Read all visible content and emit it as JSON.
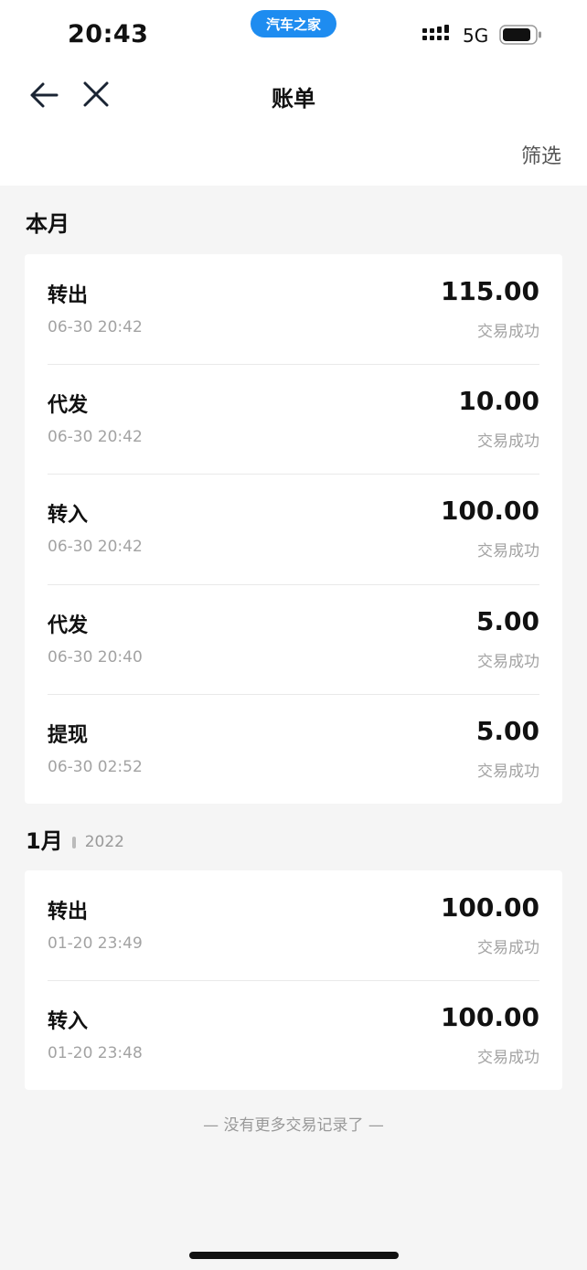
{
  "status_bar": {
    "time": "20:43",
    "app_pill": "汽车之家",
    "network": "5G",
    "icons": [
      "signal-icon",
      "battery-icon"
    ]
  },
  "nav": {
    "title": "账单",
    "back_icon": "back-arrow-icon",
    "close_icon": "close-icon",
    "filter_label": "筛选"
  },
  "sections": [
    {
      "title": "本月",
      "subtitle": "",
      "items": [
        {
          "type": "转出",
          "time": "06-30 20:42",
          "amount": "115.00",
          "status": "交易成功"
        },
        {
          "type": "代发",
          "time": "06-30 20:42",
          "amount": "10.00",
          "status": "交易成功"
        },
        {
          "type": "转入",
          "time": "06-30 20:42",
          "amount": "100.00",
          "status": "交易成功"
        },
        {
          "type": "代发",
          "time": "06-30 20:40",
          "amount": "5.00",
          "status": "交易成功"
        },
        {
          "type": "提现",
          "time": "06-30 02:52",
          "amount": "5.00",
          "status": "交易成功"
        }
      ]
    },
    {
      "title": "1月",
      "subtitle": "2022",
      "items": [
        {
          "type": "转出",
          "time": "01-20 23:49",
          "amount": "100.00",
          "status": "交易成功"
        },
        {
          "type": "转入",
          "time": "01-20 23:48",
          "amount": "100.00",
          "status": "交易成功"
        }
      ]
    }
  ],
  "footer_note": "— 没有更多交易记录了 —",
  "colors": {
    "accent": "#1e8cf0",
    "background": "#f5f5f5",
    "card": "#ffffff",
    "muted_text": "#a3a3a3"
  }
}
